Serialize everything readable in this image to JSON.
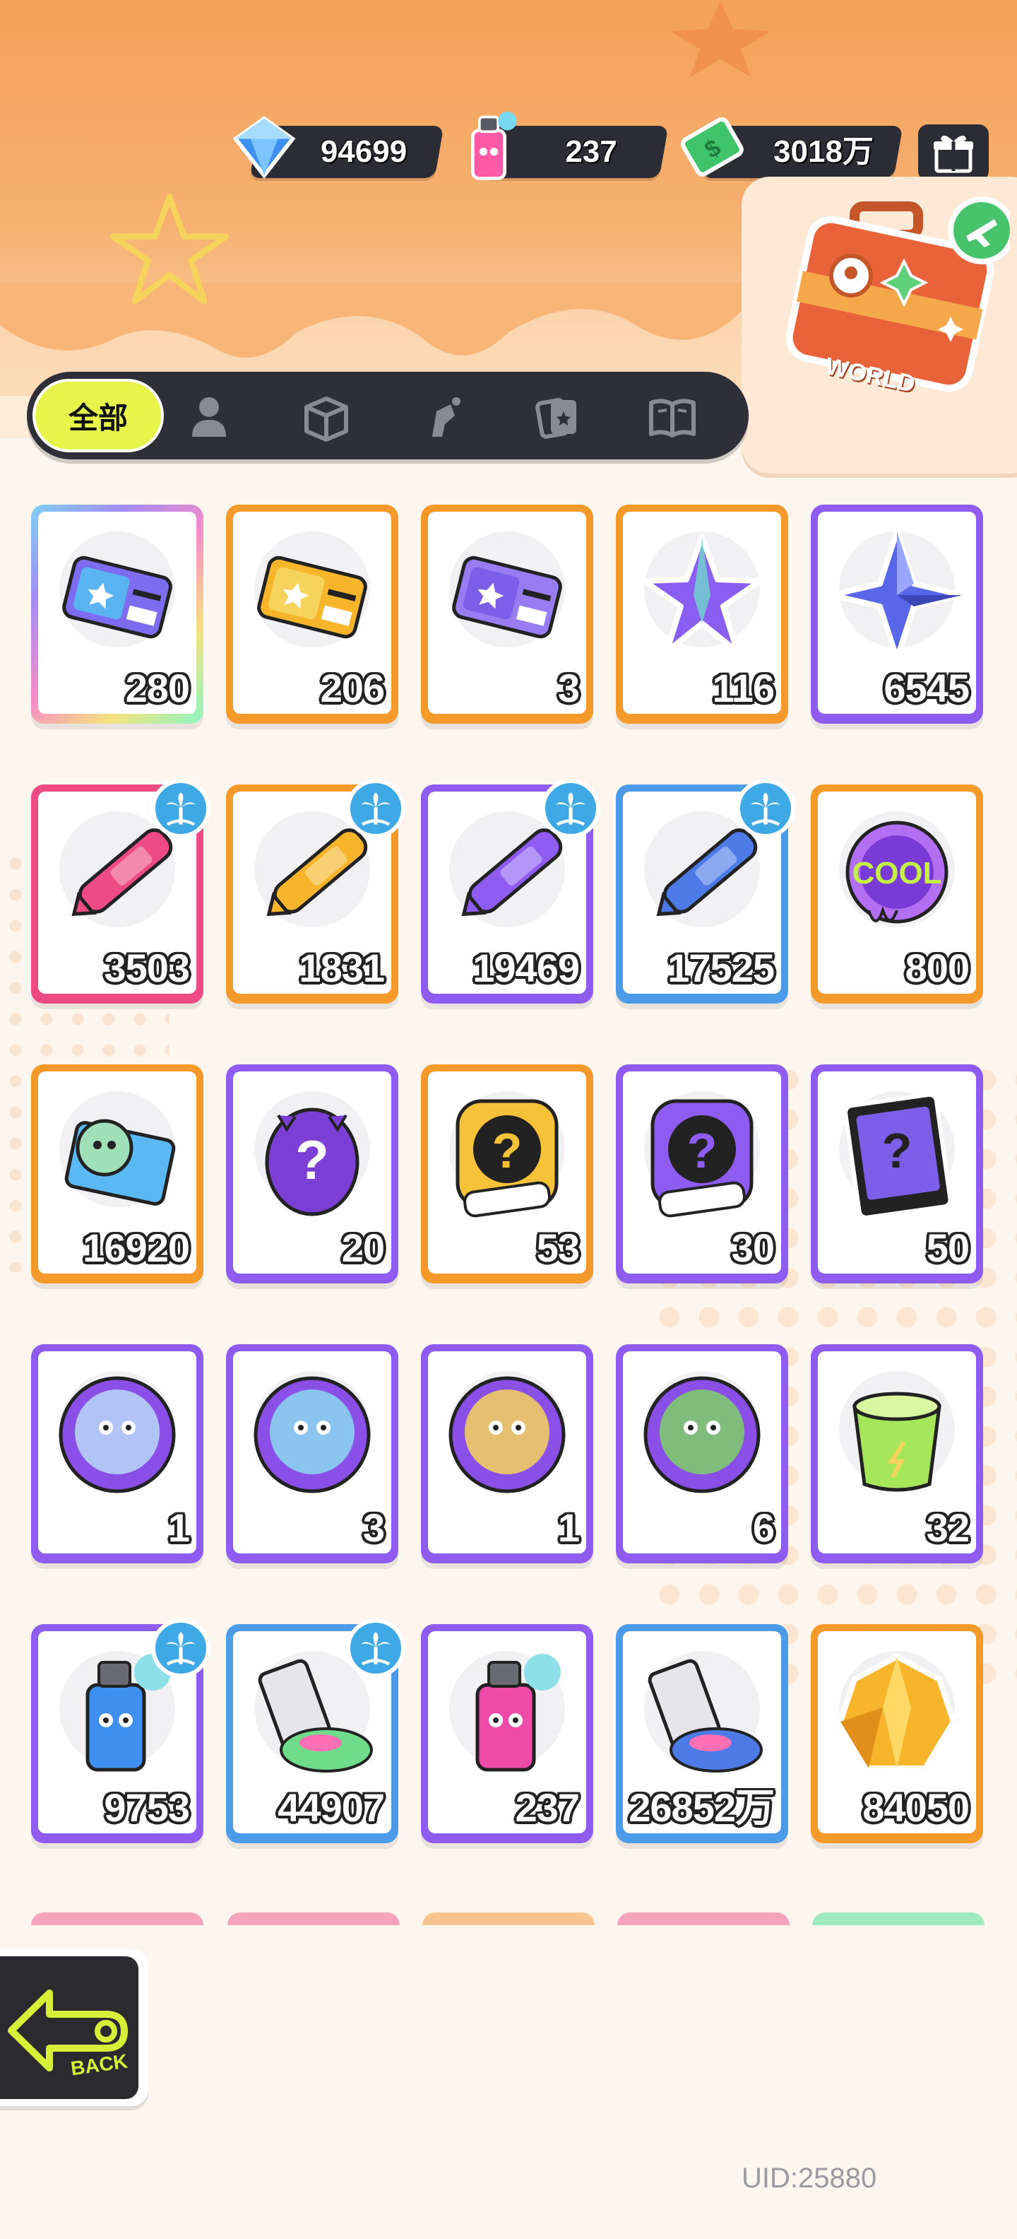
{
  "currencies": {
    "diamonds": {
      "value": "94699",
      "icon": "diamond-icon"
    },
    "spray": {
      "value": "237",
      "icon": "spray-can-icon"
    },
    "cash": {
      "value": "3018万",
      "icon": "cash-icon"
    }
  },
  "gift_button": {
    "icon": "gift-icon"
  },
  "world_button": {
    "label": "WORLD",
    "icon": "suitcase-icon"
  },
  "tabs": [
    {
      "label": "全部",
      "icon": "all",
      "selected": true
    },
    {
      "label": "",
      "icon": "person-icon"
    },
    {
      "label": "",
      "icon": "box-icon"
    },
    {
      "label": "",
      "icon": "spray-tool-icon"
    },
    {
      "label": "",
      "icon": "cards-icon"
    },
    {
      "label": "",
      "icon": "book-icon"
    }
  ],
  "items": [
    {
      "count": "280",
      "art": "ticket-purple",
      "frame": "rainbow"
    },
    {
      "count": "206",
      "art": "ticket-gold",
      "frame": "orange"
    },
    {
      "count": "3",
      "art": "ticket-violet",
      "frame": "orange"
    },
    {
      "count": "116",
      "art": "star-crystal-rainbow",
      "frame": "orange"
    },
    {
      "count": "6545",
      "art": "star-crystal-blue",
      "frame": "purple"
    },
    {
      "count": "3503",
      "art": "crayon-pink",
      "frame": "pink",
      "badge": "palm-icon"
    },
    {
      "count": "1831",
      "art": "crayon-yellow",
      "frame": "orange",
      "badge": "palm-icon"
    },
    {
      "count": "19469",
      "art": "crayon-purple",
      "frame": "purple",
      "badge": "palm-icon"
    },
    {
      "count": "17525",
      "art": "crayon-blue",
      "frame": "blue",
      "badge": "palm-icon"
    },
    {
      "count": "800",
      "art": "cool-badge",
      "frame": "orange"
    },
    {
      "count": "16920",
      "art": "season-card",
      "frame": "orange"
    },
    {
      "count": "20",
      "art": "mystery-egg",
      "frame": "purple"
    },
    {
      "count": "53",
      "art": "deity-mystery-gold",
      "frame": "orange"
    },
    {
      "count": "30",
      "art": "deity-mystery-purple",
      "frame": "purple"
    },
    {
      "count": "50",
      "art": "travel-card-mystery",
      "frame": "purple"
    },
    {
      "count": "1",
      "art": "mpets-cat",
      "frame": "purple"
    },
    {
      "count": "3",
      "art": "mpets-fish",
      "frame": "purple"
    },
    {
      "count": "1",
      "art": "mpets-jelly",
      "frame": "purple"
    },
    {
      "count": "6",
      "art": "mpets-sprout",
      "frame": "purple"
    },
    {
      "count": "32",
      "art": "green-drink",
      "frame": "purple"
    },
    {
      "count": "9753",
      "art": "spray-blue",
      "frame": "purple",
      "badge": "palm-icon"
    },
    {
      "count": "44907",
      "art": "paint-tube",
      "frame": "blue",
      "badge": "palm-icon"
    },
    {
      "count": "237",
      "art": "spray-pink",
      "frame": "purple"
    },
    {
      "count": "26852万",
      "art": "paint-tube-rainbow",
      "frame": "blue"
    },
    {
      "count": "84050",
      "art": "gold-crystal",
      "frame": "orange"
    }
  ],
  "frame_colors": {
    "orange": "#f39a2a",
    "purple": "#8e5cf0",
    "pink": "#ee4a83",
    "blue": "#4c9be8",
    "rainbow": "#7fd0f5",
    "green": "#7fe0a8"
  },
  "back_button": {
    "label": "BACK",
    "icon": "back-arrow-icon"
  },
  "uid": "UID:25880"
}
